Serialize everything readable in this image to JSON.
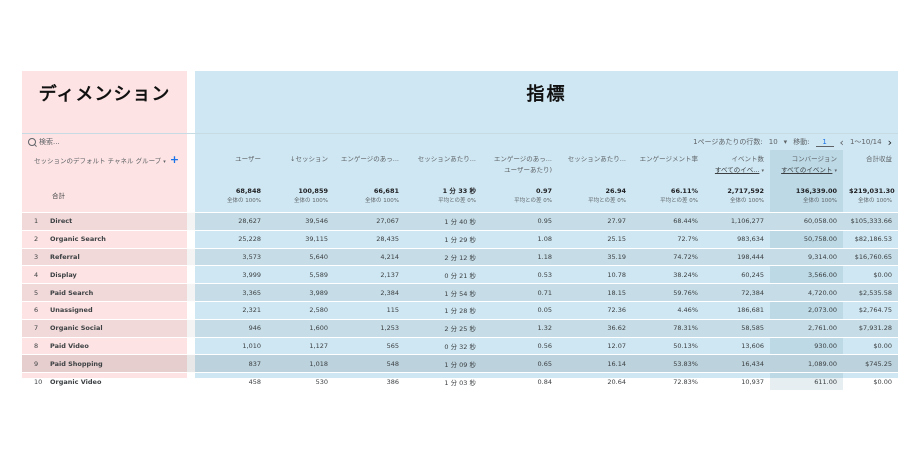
{
  "dimension_title": "ディメンション",
  "metrics_title": "指標",
  "toolbar": {
    "search_placeholder": "検索...",
    "rows_per_page_label": "1ページあたりの行数:",
    "rows_per_page_value": "10",
    "goto_label": "移動:",
    "goto_value": "1",
    "range": "1〜10/14"
  },
  "columns": [
    {
      "label": "セッションのデフォルト チャネル グループ"
    },
    {
      "label": "ユーザー"
    },
    {
      "label": "↓セッション"
    },
    {
      "label": "エンゲージのあっ..."
    },
    {
      "label": "セッションあたり..."
    },
    {
      "label": "エンゲージのあっ...",
      "sub": "ユーザーあたり)"
    },
    {
      "label": "セッションあたり..."
    },
    {
      "label": "エンゲージメント率"
    },
    {
      "label": "イベント数",
      "sub": "すべてのイベ..."
    },
    {
      "label": "コンバージョン",
      "sub": "すべてのイベント"
    },
    {
      "label": "合計収益"
    }
  ],
  "totals": {
    "label": "合計",
    "values": [
      {
        "v": "68,848",
        "s": "全体の 100%"
      },
      {
        "v": "100,859",
        "s": "全体の 100%"
      },
      {
        "v": "66,681",
        "s": "全体の 100%"
      },
      {
        "v": "1 分 33 秒",
        "s": "平均との差 0%"
      },
      {
        "v": "0.97",
        "s": "平均との差 0%"
      },
      {
        "v": "26.94",
        "s": "平均との差 0%"
      },
      {
        "v": "66.11%",
        "s": "平均との差 0%"
      },
      {
        "v": "2,717,592",
        "s": "全体の 100%"
      },
      {
        "v": "136,339.00",
        "s": "全体の 100%"
      },
      {
        "v": "$219,031.30",
        "s": "全体の 100%"
      }
    ]
  },
  "rows": [
    {
      "n": "1",
      "name": "Direct",
      "cells": [
        "28,627",
        "39,546",
        "27,067",
        "1 分 40 秒",
        "0.95",
        "27.97",
        "68.44%",
        "1,106,277",
        "60,058.00",
        "$105,333.66"
      ]
    },
    {
      "n": "2",
      "name": "Organic Search",
      "cells": [
        "25,228",
        "39,115",
        "28,435",
        "1 分 29 秒",
        "1.08",
        "25.15",
        "72.7%",
        "983,634",
        "50,758.00",
        "$82,186.53"
      ]
    },
    {
      "n": "3",
      "name": "Referral",
      "cells": [
        "3,573",
        "5,640",
        "4,214",
        "2 分 12 秒",
        "1.18",
        "35.19",
        "74.72%",
        "198,444",
        "9,314.00",
        "$16,760.65"
      ]
    },
    {
      "n": "4",
      "name": "Display",
      "cells": [
        "3,999",
        "5,589",
        "2,137",
        "0 分 21 秒",
        "0.53",
        "10.78",
        "38.24%",
        "60,245",
        "3,566.00",
        "$0.00"
      ]
    },
    {
      "n": "5",
      "name": "Paid Search",
      "cells": [
        "3,365",
        "3,989",
        "2,384",
        "1 分 54 秒",
        "0.71",
        "18.15",
        "59.76%",
        "72,384",
        "4,720.00",
        "$2,535.58"
      ]
    },
    {
      "n": "6",
      "name": "Unassigned",
      "cells": [
        "2,321",
        "2,580",
        "115",
        "1 分 28 秒",
        "0.05",
        "72.36",
        "4.46%",
        "186,681",
        "2,073.00",
        "$2,764.75"
      ]
    },
    {
      "n": "7",
      "name": "Organic Social",
      "cells": [
        "946",
        "1,600",
        "1,253",
        "2 分 25 秒",
        "1.32",
        "36.62",
        "78.31%",
        "58,585",
        "2,761.00",
        "$7,931.28"
      ]
    },
    {
      "n": "8",
      "name": "Paid Video",
      "cells": [
        "1,010",
        "1,127",
        "565",
        "0 分 32 秒",
        "0.56",
        "12.07",
        "50.13%",
        "13,606",
        "930.00",
        "$0.00"
      ]
    },
    {
      "n": "9",
      "name": "Paid Shopping",
      "cells": [
        "837",
        "1,018",
        "548",
        "1 分 09 秒",
        "0.65",
        "16.14",
        "53.83%",
        "16,434",
        "1,089.00",
        "$745.25"
      ]
    },
    {
      "n": "10",
      "name": "Organic Video",
      "cells": [
        "458",
        "530",
        "386",
        "1 分 03 秒",
        "0.84",
        "20.64",
        "72.83%",
        "10,937",
        "611.00",
        "$0.00"
      ]
    }
  ]
}
